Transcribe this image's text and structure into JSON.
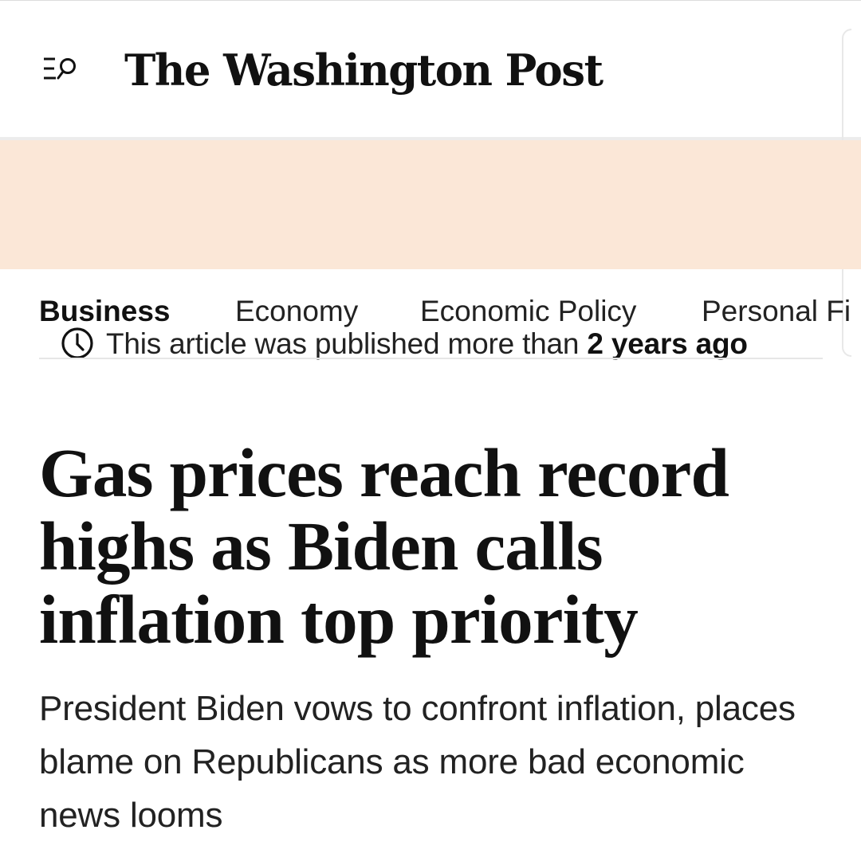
{
  "header": {
    "brand_name": "The Washington Post",
    "menu_icon": "menu-search-icon"
  },
  "age_banner": {
    "icon": "clock-icon",
    "prefix": "This article was published more than ",
    "emphasis": "2 years ago",
    "background_color": "#fbe7d7"
  },
  "sections": [
    {
      "label": "Business",
      "active": true
    },
    {
      "label": "Economy",
      "active": false
    },
    {
      "label": "Economic Policy",
      "active": false
    },
    {
      "label": "Personal Fi",
      "active": false
    }
  ],
  "article": {
    "headline": "Gas prices reach record highs as Biden calls inflation top priority",
    "subheadline": "President Biden vows to confront inflation, places blame on Republicans as more bad economic news looms"
  },
  "colors": {
    "text": "#111111",
    "muted_divider": "#e6e6e6",
    "banner": "#fbe7d7"
  }
}
